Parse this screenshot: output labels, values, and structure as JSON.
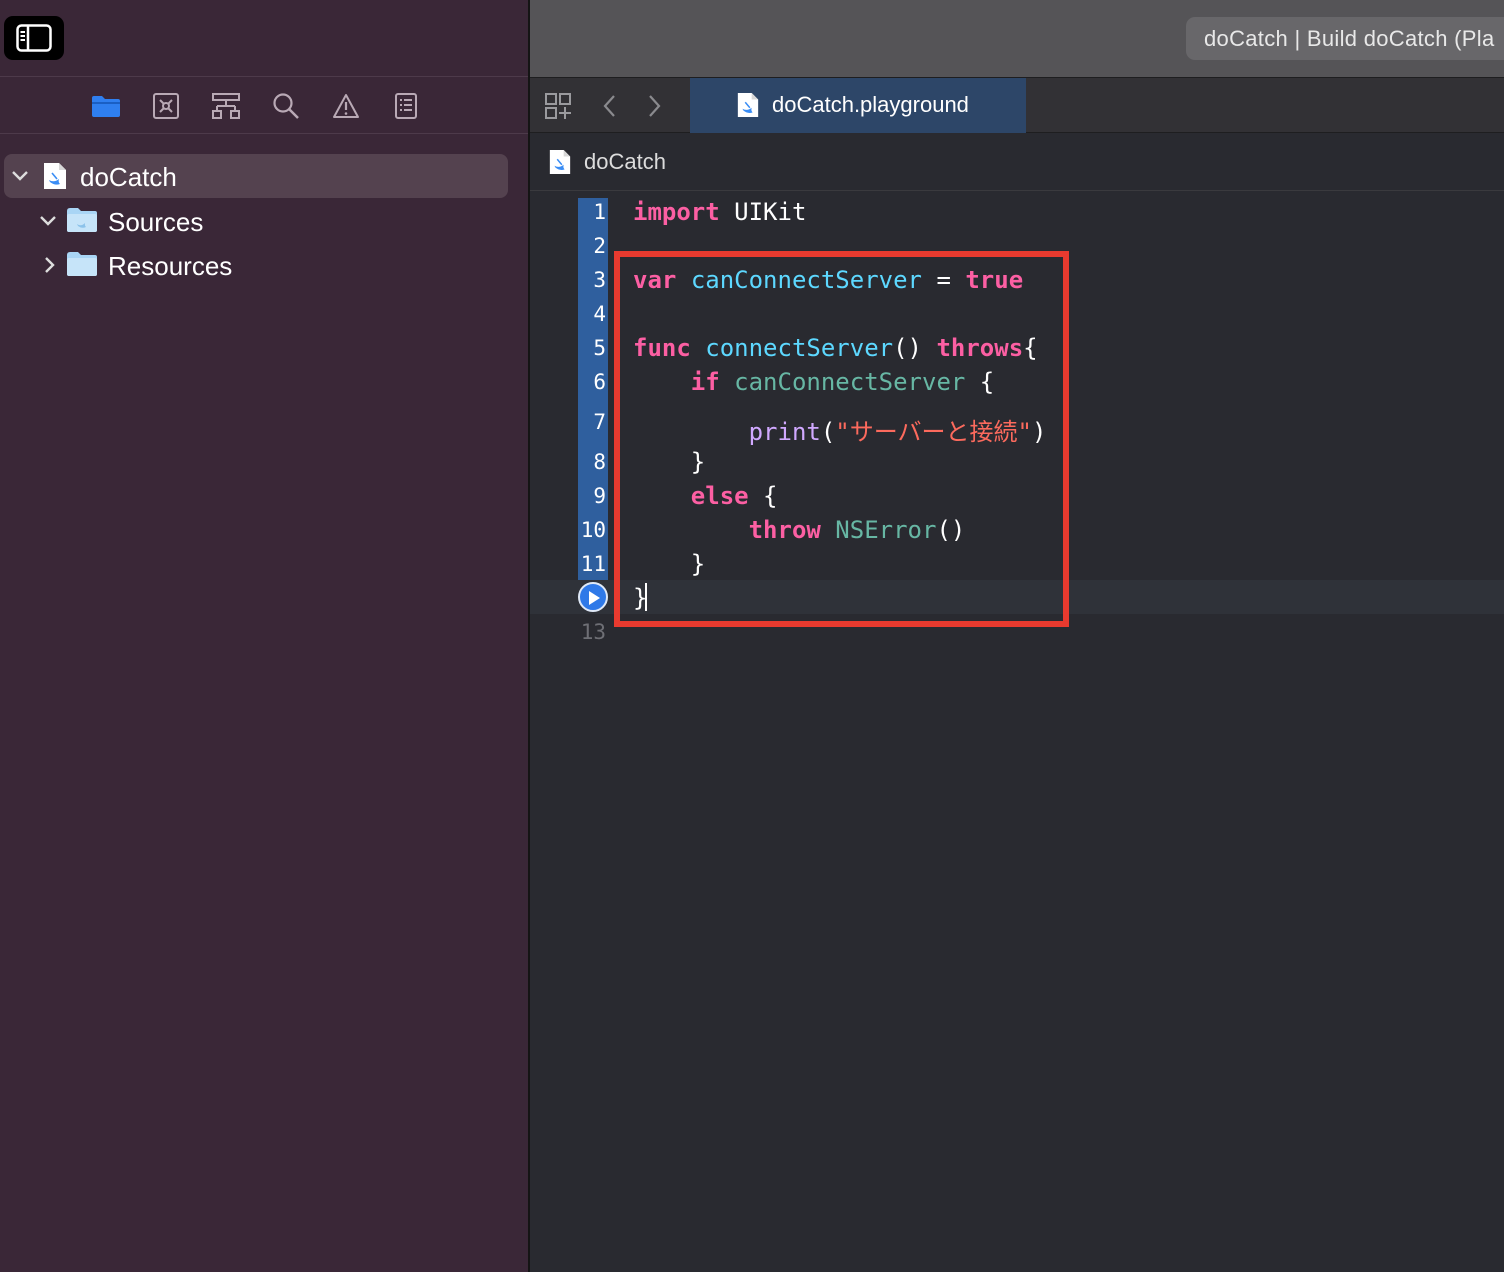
{
  "window": {
    "title": "doCatch | Build doCatch (Pla"
  },
  "sidebar": {
    "nav_icons": [
      "folder-icon",
      "source-control-icon",
      "hierarchy-icon",
      "search-icon",
      "warning-icon",
      "report-icon"
    ],
    "tree": [
      {
        "label": "doCatch",
        "expanded": true,
        "icon": "swift-file-icon",
        "selected": true
      },
      {
        "label": "Sources",
        "expanded": true,
        "icon": "folder-icon"
      },
      {
        "label": "Resources",
        "expanded": false,
        "icon": "folder-icon"
      }
    ]
  },
  "editor": {
    "tab_label": "doCatch.playground",
    "jump_bar": "doCatch",
    "line_numbers": [
      "1",
      "2",
      "3",
      "4",
      "5",
      "6",
      "7",
      "8",
      "9",
      "10",
      "11",
      "13"
    ],
    "code": {
      "l1_kw": "import",
      "l1_rest": " UIKit",
      "l3_kw": "var",
      "l3_name": "canConnectServer",
      "l3_eq": " = ",
      "l3_val": "true",
      "l5_kw": "func",
      "l5_name": "connectServer",
      "l5_paren": "() ",
      "l5_throws": "throws",
      "l5_brace": "{",
      "l6_kw": "if",
      "l6_ref": "canConnectServer",
      "l6_brace": " {",
      "l7_fn": "print",
      "l7_open": "(",
      "l7_str": "\"サーバーと接続\"",
      "l7_close": ")",
      "l8": "}",
      "l9_kw": "else",
      "l9_brace": " {",
      "l10_kw": "throw",
      "l10_ref": "NSError",
      "l10_paren": "()",
      "l11": "}",
      "l12": "}"
    }
  },
  "colors": {
    "highlight_box": "#e83a2f",
    "accent": "#2f79e8",
    "keyword": "#fc5fa3",
    "string": "#fc6a5d"
  }
}
